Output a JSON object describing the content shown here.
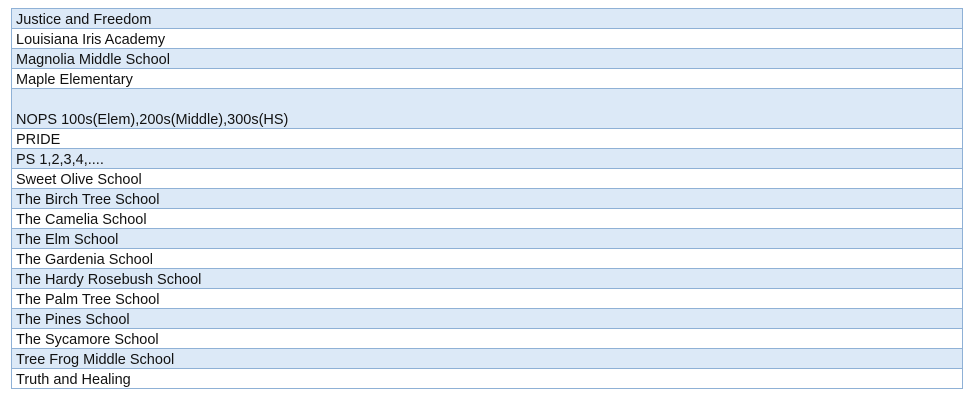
{
  "rows": [
    "Justice and Freedom",
    "Louisiana Iris Academy",
    "Magnolia Middle School",
    "Maple Elementary",
    "NOPS 100s(Elem),200s(Middle),300s(HS)",
    "PRIDE",
    "PS 1,2,3,4,....",
    "Sweet Olive School",
    "The Birch Tree School",
    "The Camelia School",
    "The Elm School",
    "The Gardenia School",
    "The Hardy Rosebush School",
    "The Palm Tree School",
    "The Pines School",
    "The Sycamore School",
    "Tree Frog Middle School",
    "Truth and Healing"
  ],
  "colors": {
    "shaded_row": "#dce9f7",
    "plain_row": "#ffffff",
    "border": "#8fb1d6"
  }
}
